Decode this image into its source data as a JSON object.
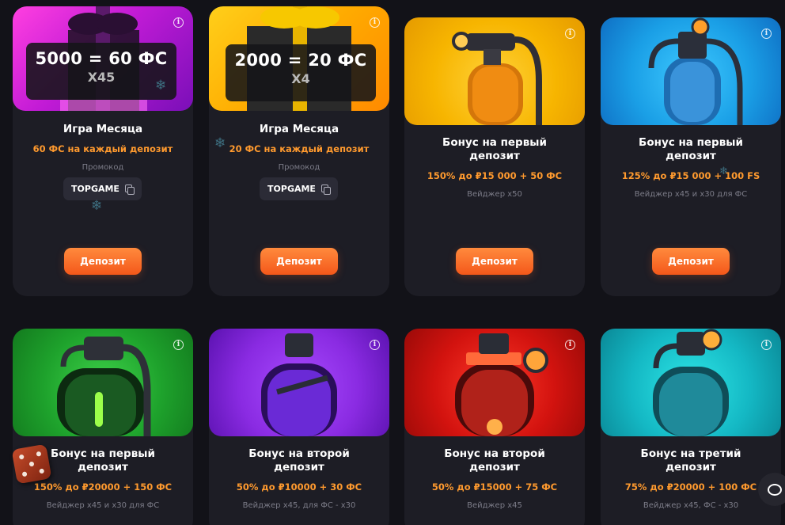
{
  "icons": {
    "info": "info-icon",
    "copy": "copy-icon",
    "snowflake": "snowflake-icon",
    "chat": "chat-icon",
    "dice": "dice-icon"
  },
  "glyphs": {
    "info": "i",
    "snowflake": "❄"
  },
  "colors": {
    "background": "#121218",
    "card": "#1d1d25",
    "accent_orange": "#ff9a2e",
    "button": "#f4581a"
  },
  "cards": [
    {
      "image_label_line1": "5000 = 60 ФС",
      "image_label_line2": "X45",
      "title": "Игра Месяца",
      "offer": "60 ФС на каждый депозит",
      "promo_label": "Промокод",
      "promo_code": "TOPGAME",
      "button": "Депозит"
    },
    {
      "image_label_line1": "2000 = 20 ФС",
      "image_label_line2": "X4",
      "title": "Игра Месяца",
      "offer": "20 ФС на каждый депозит",
      "promo_label": "Промокод",
      "promo_code": "TOPGAME",
      "button": "Депозит"
    },
    {
      "title_line1": "Бонус на первый",
      "title_line2": "депозит",
      "offer": "150% до ₽15 000 + 50 ФС",
      "wager": "Вейджер x50",
      "button": "Депозит"
    },
    {
      "title_line1": "Бонус на первый",
      "title_line2": "депозит",
      "offer": "125% до ₽15 000 + 100 FS",
      "wager": "Вейджер x45 и x30 для ФС",
      "button": "Депозит"
    },
    {
      "title_line1": "Бонус на первый",
      "title_line2": "депозит",
      "offer": "150% до ₽20000 + 150 ФС",
      "wager": "Вейджер x45 и x30 для ФС"
    },
    {
      "title_line1": "Бонус на второй",
      "title_line2": "депозит",
      "offer": "50% до ₽10000 + 30 ФС",
      "wager": "Вейджер x45, для ФС - x30"
    },
    {
      "title_line1": "Бонус на второй",
      "title_line2": "депозит",
      "offer": "50% до ₽15000 + 75 ФС",
      "wager": "Вейджер x45"
    },
    {
      "title_line1": "Бонус на третий",
      "title_line2": "депозит",
      "offer": "75% до ₽20000 + 100 ФС",
      "wager": "Вейджер x45, ФС - x30"
    }
  ]
}
